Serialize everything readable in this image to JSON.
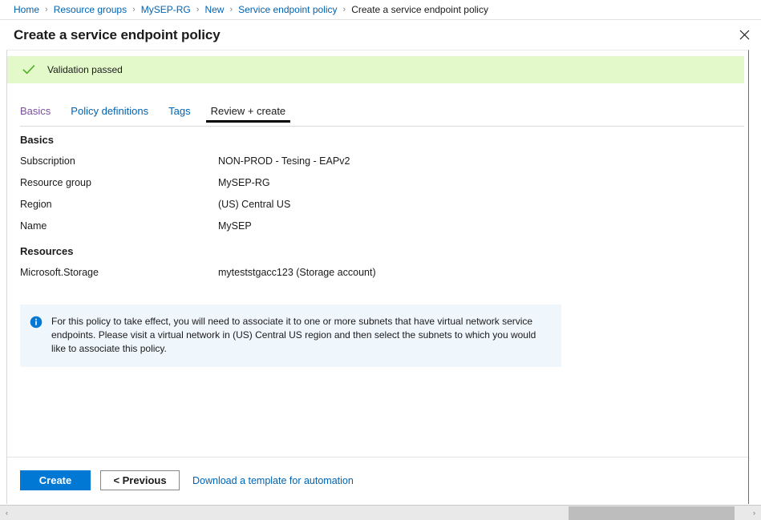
{
  "breadcrumb": {
    "separator": "›",
    "items": [
      {
        "label": "Home",
        "current": false
      },
      {
        "label": "Resource groups",
        "current": false
      },
      {
        "label": "MySEP-RG",
        "current": false
      },
      {
        "label": "New",
        "current": false
      },
      {
        "label": "Service endpoint policy",
        "current": false
      },
      {
        "label": "Create a service endpoint policy",
        "current": true
      }
    ]
  },
  "blade": {
    "title": "Create a service endpoint policy",
    "close_icon": "close-icon"
  },
  "validation": {
    "icon": "checkmark-icon",
    "message": "Validation passed",
    "background": "#e4f9ca",
    "icon_color": "#4caf20"
  },
  "tabs": [
    {
      "label": "Basics",
      "state": "visited"
    },
    {
      "label": "Policy definitions",
      "state": "link"
    },
    {
      "label": "Tags",
      "state": "link"
    },
    {
      "label": "Review + create",
      "state": "active"
    }
  ],
  "sections": [
    {
      "title": "Basics",
      "rows": [
        {
          "label": "Subscription",
          "value": "NON-PROD - Tesing - EAPv2"
        },
        {
          "label": "Resource group",
          "value": "MySEP-RG"
        },
        {
          "label": "Region",
          "value": "(US) Central US"
        },
        {
          "label": "Name",
          "value": "MySEP"
        }
      ]
    },
    {
      "title": "Resources",
      "rows": [
        {
          "label": "Microsoft.Storage",
          "value": "myteststgacc123 (Storage account)"
        }
      ]
    }
  ],
  "info_banner": {
    "icon": "info-icon",
    "text": "For this policy to take effect, you will need to associate it to one or more subnets that have virtual network service endpoints. Please visit a virtual network in (US) Central US region and then select the subnets to which you would like to associate this policy.",
    "background": "#eff6fc",
    "icon_color": "#0078d4"
  },
  "footer": {
    "create_label": "Create",
    "previous_label": "< Previous",
    "template_link_label": "Download a template for automation",
    "primary_color": "#0078d4"
  },
  "scrollbar": {
    "left_arrow": "‹",
    "right_arrow": "›"
  }
}
